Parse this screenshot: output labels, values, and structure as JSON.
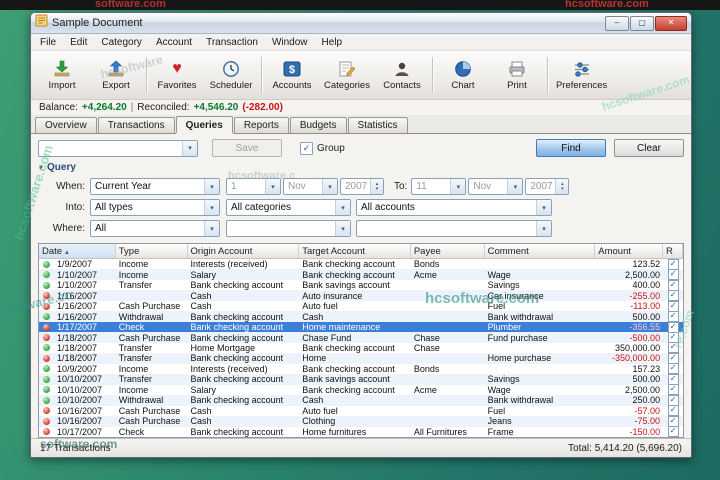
{
  "window": {
    "title": "Sample Document"
  },
  "icons": {
    "minimize": "–",
    "maximize": "▢",
    "close": "✕",
    "dropdown": "▾",
    "spin_up": "▴",
    "spin_down": "▾",
    "check": "✓",
    "sort": "▴",
    "heart": "♥",
    "expander": "▾"
  },
  "menu": {
    "items": [
      "File",
      "Edit",
      "Category",
      "Account",
      "Transaction",
      "Window",
      "Help"
    ]
  },
  "toolbar": {
    "items": [
      {
        "label": "Import",
        "icon": "import-icon"
      },
      {
        "label": "Export",
        "icon": "export-icon"
      },
      {
        "label": "Favorites",
        "icon": "heart-icon"
      },
      {
        "label": "Scheduler",
        "icon": "clock-icon"
      },
      {
        "label": "Accounts",
        "icon": "dollar-icon"
      },
      {
        "label": "Categories",
        "icon": "pencil-page-icon"
      },
      {
        "label": "Contacts",
        "icon": "person-icon"
      },
      {
        "label": "Chart",
        "icon": "pie-chart-icon"
      },
      {
        "label": "Print",
        "icon": "printer-icon"
      },
      {
        "label": "Preferences",
        "icon": "sliders-icon"
      }
    ]
  },
  "balance": {
    "label": "Balance:",
    "value": "+4,264.20",
    "separator": "|",
    "reconciled_label": "Reconciled:",
    "reconciled_value": "+4,546.20",
    "reconciled_delta": "(-282.00)"
  },
  "tabs": {
    "items": [
      "Overview",
      "Transactions",
      "Queries",
      "Reports",
      "Budgets",
      "Statistics"
    ],
    "active": "Queries"
  },
  "querybar": {
    "saved_query_value": "",
    "save_label": "Save",
    "group_label": "Group",
    "find_label": "Find",
    "clear_label": "Clear"
  },
  "query": {
    "section_label": "Query",
    "when_label": "When:",
    "when_preset": "Current Year",
    "from_day": "1",
    "from_month": "Nov",
    "from_year": "2007",
    "to_label": "To:",
    "to_day": "11",
    "to_month": "Nov",
    "to_year": "2007",
    "into_label": "Into:",
    "into_type": "All types",
    "into_category": "All categories",
    "into_account": "All accounts",
    "where_label": "Where:",
    "where_field": "All",
    "where_op": "",
    "where_value": ""
  },
  "table": {
    "columns": [
      "Date",
      "Type",
      "Origin Account",
      "Target Account",
      "Payee",
      "Comment",
      "Amount",
      "R"
    ],
    "sort_column": "Date",
    "rows": [
      {
        "date": "1/9/2007",
        "type": "Income",
        "origin": "Interests (received)",
        "target": "Bank checking account",
        "payee": "Bonds",
        "comment": "",
        "amount": "123.52",
        "dot": "green",
        "reconciled": true
      },
      {
        "date": "1/10/2007",
        "type": "Income",
        "origin": "Salary",
        "target": "Bank checking account",
        "payee": "Acme",
        "comment": "Wage",
        "amount": "2,500.00",
        "dot": "green",
        "reconciled": true
      },
      {
        "date": "1/10/2007",
        "type": "Transfer",
        "origin": "Bank checking account",
        "target": "Bank savings account",
        "payee": "",
        "comment": "Savings",
        "amount": "400.00",
        "dot": "green",
        "reconciled": true
      },
      {
        "date": "1/16/2007",
        "type": "",
        "origin": "Cash",
        "target": "Auto insurance",
        "payee": "",
        "comment": "Car insurance",
        "amount": "-255.00",
        "dot": "red",
        "reconciled": true
      },
      {
        "date": "1/16/2007",
        "type": "Cash Purchase",
        "origin": "Cash",
        "target": "Auto fuel",
        "payee": "",
        "comment": "Fuel",
        "amount": "-113.00",
        "dot": "red",
        "reconciled": true
      },
      {
        "date": "1/16/2007",
        "type": "Withdrawal",
        "origin": "Bank checking account",
        "target": "Cash",
        "payee": "",
        "comment": "Bank withdrawal",
        "amount": "500.00",
        "dot": "green",
        "reconciled": true
      },
      {
        "date": "1/17/2007",
        "type": "Check",
        "origin": "Bank checking account",
        "target": "Home maintenance",
        "payee": "",
        "comment": "Plumber",
        "amount": "-356.55",
        "dot": "red",
        "reconciled": true,
        "selected": true
      },
      {
        "date": "1/18/2007",
        "type": "Cash Purchase",
        "origin": "Bank checking account",
        "target": "Chase Fund",
        "payee": "Chase",
        "comment": "Fund purchase",
        "amount": "-500.00",
        "dot": "red",
        "reconciled": true
      },
      {
        "date": "1/18/2007",
        "type": "Transfer",
        "origin": "Home Mortgage",
        "target": "Bank checking account",
        "payee": "Chase",
        "comment": "",
        "amount": "350,000.00",
        "dot": "green",
        "reconciled": true
      },
      {
        "date": "1/18/2007",
        "type": "Transfer",
        "origin": "Bank checking account",
        "target": "Home",
        "payee": "",
        "comment": "Home purchase",
        "amount": "-350,000.00",
        "dot": "red",
        "reconciled": true
      },
      {
        "date": "10/9/2007",
        "type": "Income",
        "origin": "Interests (received)",
        "target": "Bank checking account",
        "payee": "Bonds",
        "comment": "",
        "amount": "157.23",
        "dot": "green",
        "reconciled": true
      },
      {
        "date": "10/10/2007",
        "type": "Transfer",
        "origin": "Bank checking account",
        "target": "Bank savings account",
        "payee": "",
        "comment": "Savings",
        "amount": "500.00",
        "dot": "green",
        "reconciled": true
      },
      {
        "date": "10/10/2007",
        "type": "Income",
        "origin": "Salary",
        "target": "Bank checking account",
        "payee": "Acme",
        "comment": "Wage",
        "amount": "2,500.00",
        "dot": "green",
        "reconciled": true
      },
      {
        "date": "10/10/2007",
        "type": "Withdrawal",
        "origin": "Bank checking account",
        "target": "Cash",
        "payee": "",
        "comment": "Bank withdrawal",
        "amount": "250.00",
        "dot": "green",
        "reconciled": true
      },
      {
        "date": "10/16/2007",
        "type": "Cash Purchase",
        "origin": "Cash",
        "target": "Auto fuel",
        "payee": "",
        "comment": "Fuel",
        "amount": "-57.00",
        "dot": "red",
        "reconciled": true
      },
      {
        "date": "10/16/2007",
        "type": "Cash Purchase",
        "origin": "Cash",
        "target": "Clothing",
        "payee": "",
        "comment": "Jeans",
        "amount": "-75.00",
        "dot": "red",
        "reconciled": true
      },
      {
        "date": "10/17/2007",
        "type": "Check",
        "origin": "Bank checking account",
        "target": "Home furnitures",
        "payee": "All Furnitures",
        "comment": "Frame",
        "amount": "-150.00",
        "dot": "red",
        "reconciled": true
      }
    ]
  },
  "statusbar": {
    "left": "17 Transactions",
    "right": "Total: 5,414.20 (5,696.20)"
  },
  "watermarks": [
    "software.com",
    "hcsoftware.com",
    "hcsoftware.com",
    "hcsoftware",
    "hcsoftware.c",
    "hcsoftware.com",
    "csoftware.co",
    "software.com",
    "re.com",
    "hcsoftware.com"
  ],
  "colors": {
    "selection": "#3c7fd9",
    "negative": "#cc1111",
    "positive": "#0a7a2f",
    "find_button": "#7fb2e0",
    "desktop": "#2d8a6e"
  }
}
